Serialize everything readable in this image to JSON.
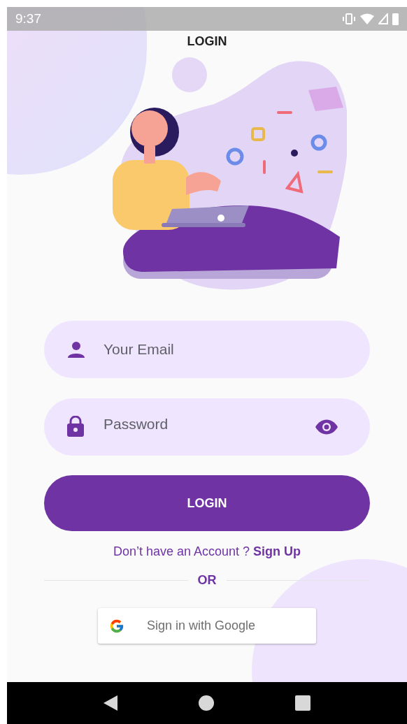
{
  "status_bar": {
    "time": "9:37"
  },
  "title": "LOGIN",
  "email_field": {
    "placeholder": "Your Email"
  },
  "password_field": {
    "placeholder": "Password"
  },
  "login_button": "LOGIN",
  "signup_prompt": {
    "text": "Don’t have an Account ? ",
    "link": "Sign Up"
  },
  "divider_text": "OR",
  "google_button": "Sign in with Google"
}
